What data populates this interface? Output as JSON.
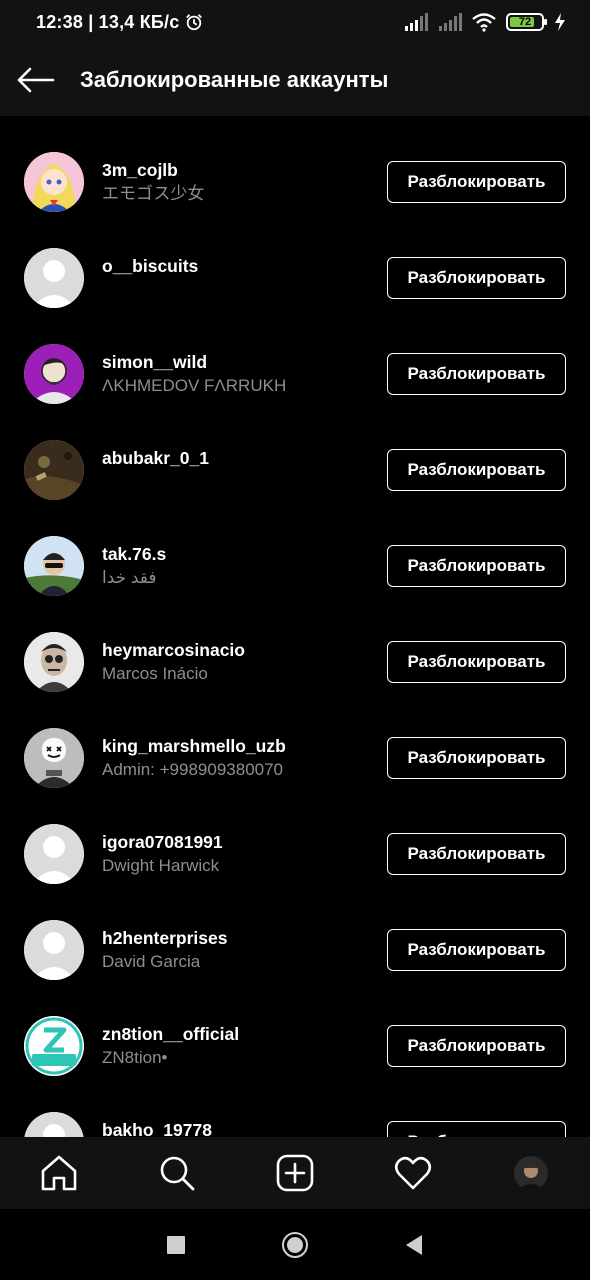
{
  "status_bar": {
    "time_speed": "12:38 | 13,4 КБ/с",
    "battery": "72"
  },
  "header": {
    "title": "Заблокированные аккаунты"
  },
  "unblock_label": "Разблокировать",
  "accounts": [
    {
      "username": "3m_cojlb",
      "fullname": "エモゴス少女"
    },
    {
      "username": "o__biscuits",
      "fullname": ""
    },
    {
      "username": "simon__wild",
      "fullname": "ΛKHMEDOV FΛRRUKH"
    },
    {
      "username": "abubakr_0_1",
      "fullname": ""
    },
    {
      "username": "tak.76.s",
      "fullname": "فقد خدا"
    },
    {
      "username": "heymarcosinacio",
      "fullname": "Marcos Inácio"
    },
    {
      "username": "king_marshmello_uzb",
      "fullname": "Admin: +998909380070"
    },
    {
      "username": "igora07081991",
      "fullname": "Dwight Harwick"
    },
    {
      "username": "h2henterprises",
      "fullname": "David Garcia"
    },
    {
      "username": "zn8tion__official",
      "fullname": "ZN8tion•"
    },
    {
      "username": "bakho_19778",
      "fullname": ""
    }
  ],
  "colors": {
    "background": "#000000",
    "bar": "#121212",
    "secondary_text": "#8e8e8e",
    "battery_fill": "#7bc843"
  }
}
